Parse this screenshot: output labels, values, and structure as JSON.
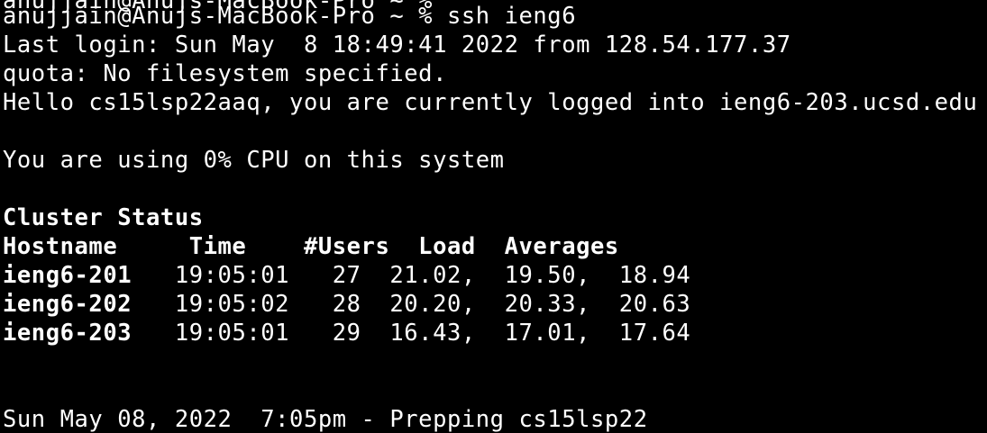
{
  "terminal": {
    "partial_top": "anujjain@Anujs-MacBook-Pro ~ %",
    "prompt": "anujjain@Anujs-MacBook-Pro ~ % ",
    "command": "ssh ieng6",
    "last_login": "Last login: Sun May  8 18:49:41 2022 from 128.54.177.37",
    "quota": "quota: No filesystem specified.",
    "hello": "Hello cs15lsp22aaq, you are currently logged into ieng6-203.ucsd.edu",
    "cpu": "You are using 0% CPU on this system",
    "cluster_title": "Cluster Status",
    "cluster_header": "Hostname     Time    #Users  Load  Averages",
    "cluster_rows": [
      {
        "host": "ieng6-201",
        "rest": "   19:05:01   27  21.02,  19.50,  18.94"
      },
      {
        "host": "ieng6-202",
        "rest": "   19:05:02   28  20.20,  20.33,  20.63"
      },
      {
        "host": "ieng6-203",
        "rest": "   19:05:01   29  16.43,  17.01,  17.64"
      }
    ],
    "footer": "Sun May 08, 2022  7:05pm - Prepping cs15lsp22"
  },
  "colors": {
    "background": "#000000",
    "foreground": "#ffffff"
  }
}
